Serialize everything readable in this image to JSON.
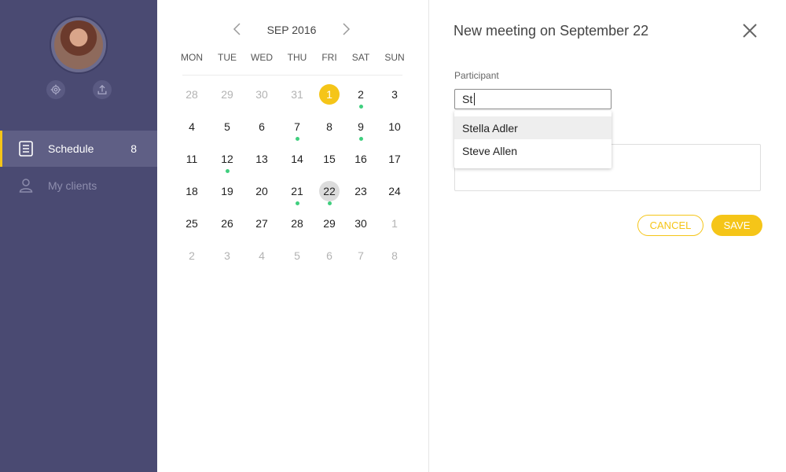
{
  "colors": {
    "sidebar_bg": "#4a4a72",
    "accent": "#f5c518",
    "event_dot": "#3fcf7e",
    "selected_day": "#dcdcdc"
  },
  "sidebar": {
    "avatar": "user-avatar",
    "actions": [
      {
        "icon": "gear-icon"
      },
      {
        "icon": "upload-icon"
      }
    ],
    "items": [
      {
        "label": "Schedule",
        "count": "8",
        "icon": "document-icon",
        "active": true
      },
      {
        "label": "My clients",
        "count": "",
        "icon": "user-icon",
        "active": false
      }
    ]
  },
  "calendar": {
    "month_label": "SEP 2016",
    "weekdays": [
      "MON",
      "TUE",
      "WED",
      "THU",
      "FRI",
      "SAT",
      "SUN"
    ],
    "weeks": [
      [
        {
          "d": "28",
          "muted": true
        },
        {
          "d": "29",
          "muted": true
        },
        {
          "d": "30",
          "muted": true
        },
        {
          "d": "31",
          "muted": true
        },
        {
          "d": "1",
          "today": true
        },
        {
          "d": "2",
          "dot": true
        },
        {
          "d": "3"
        }
      ],
      [
        {
          "d": "4"
        },
        {
          "d": "5"
        },
        {
          "d": "6"
        },
        {
          "d": "7",
          "dot": true
        },
        {
          "d": "8"
        },
        {
          "d": "9",
          "dot": true
        },
        {
          "d": "10"
        }
      ],
      [
        {
          "d": "11"
        },
        {
          "d": "12",
          "dot": true
        },
        {
          "d": "13"
        },
        {
          "d": "14"
        },
        {
          "d": "15"
        },
        {
          "d": "16"
        },
        {
          "d": "17"
        }
      ],
      [
        {
          "d": "18"
        },
        {
          "d": "19"
        },
        {
          "d": "20"
        },
        {
          "d": "21",
          "dot": true
        },
        {
          "d": "22",
          "selected": true,
          "dot": true
        },
        {
          "d": "23"
        },
        {
          "d": "24"
        }
      ],
      [
        {
          "d": "25"
        },
        {
          "d": "26"
        },
        {
          "d": "27"
        },
        {
          "d": "28"
        },
        {
          "d": "29"
        },
        {
          "d": "30"
        },
        {
          "d": "1",
          "muted": true
        }
      ],
      [
        {
          "d": "2",
          "muted": true
        },
        {
          "d": "3",
          "muted": true
        },
        {
          "d": "4",
          "muted": true
        },
        {
          "d": "5",
          "muted": true
        },
        {
          "d": "6",
          "muted": true
        },
        {
          "d": "7",
          "muted": true
        },
        {
          "d": "8",
          "muted": true
        }
      ]
    ]
  },
  "meeting": {
    "title": "New meeting on September 22",
    "participant_label": "Participant",
    "participant_value": "St",
    "suggestions": [
      "Stella Adler",
      "Steve Allen"
    ],
    "cancel_label": "CANCEL",
    "save_label": "SAVE"
  }
}
